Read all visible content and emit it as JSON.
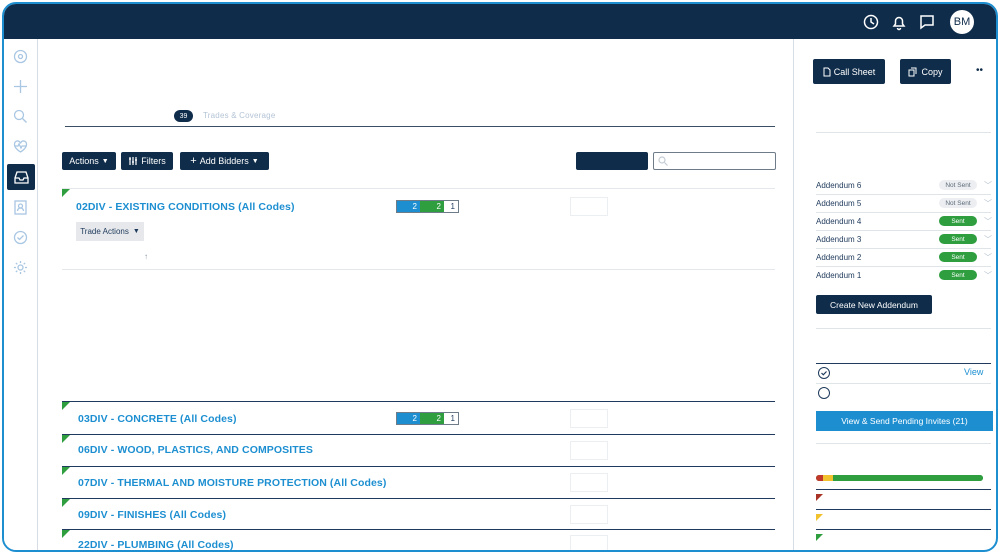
{
  "header": {
    "avatar_initials": "BM",
    "icons": [
      "history-icon",
      "bell-icon",
      "chat-icon"
    ]
  },
  "sidebar": {
    "icons": [
      "dashboard-icon",
      "plus-icon",
      "search-icon",
      "health-icon",
      "inbox-icon",
      "contacts-icon",
      "shield-check-icon",
      "gear-icon"
    ],
    "active_index": 4
  },
  "tabs": {
    "count_badge": "39",
    "trades_label": "Trades & Coverage"
  },
  "toolbar": {
    "actions_label": "Actions",
    "filters_label": "Filters",
    "add_bidders_label": "Add Bidders",
    "search_value": "",
    "search_placeholder": ""
  },
  "trades": [
    {
      "title": "02DIV - EXISTING CONDITIONS (All Codes)",
      "counts": [
        "2",
        "2",
        "1"
      ],
      "expanded": true
    },
    {
      "title": "03DIV - CONCRETE (All Codes)",
      "counts": [
        "2",
        "2",
        "1"
      ],
      "expanded": false
    },
    {
      "title": "06DIV - WOOD, PLASTICS, AND COMPOSITES",
      "counts": null,
      "expanded": false
    },
    {
      "title": "07DIV - THERMAL AND MOISTURE PROTECTION (All Codes)",
      "counts": null,
      "expanded": false
    },
    {
      "title": "09DIV - FINISHES (All Codes)",
      "counts": null,
      "expanded": false
    },
    {
      "title": "22DIV - PLUMBING (All Codes)",
      "counts": null,
      "expanded": false
    }
  ],
  "trade_actions_label": "Trade Actions",
  "sort_arrow": "↑",
  "right_panel": {
    "call_sheet_label": "Call Sheet",
    "copy_label": "Copy",
    "more_label": "••",
    "addenda": [
      {
        "name": "Addendum 6",
        "status": "Not Sent"
      },
      {
        "name": "Addendum 5",
        "status": "Not Sent"
      },
      {
        "name": "Addendum 4",
        "status": "Sent"
      },
      {
        "name": "Addendum 3",
        "status": "Sent"
      },
      {
        "name": "Addendum 2",
        "status": "Sent"
      },
      {
        "name": "Addendum 1",
        "status": "Sent"
      }
    ],
    "create_addendum_label": "Create New Addendum",
    "view_label": "View",
    "pending_invites_label": "View & Send Pending Invites (21)",
    "progress": {
      "red": 0.04,
      "yellow": 0.06,
      "green": 0.9
    },
    "colors": {
      "red": "#c0392b",
      "yellow": "#f2c12e",
      "green": "#2e9e3f"
    }
  }
}
